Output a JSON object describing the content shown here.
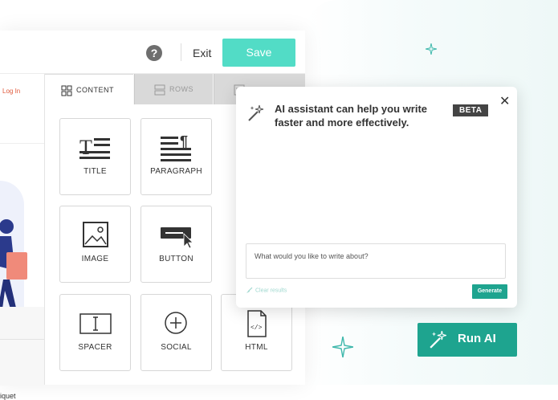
{
  "topbar": {
    "help": "?",
    "exit_label": "Exit",
    "save_label": "Save"
  },
  "canvas_preview": {
    "login_link": "Log In",
    "snippet_text": "iquet"
  },
  "tabs": [
    {
      "label": "CONTENT",
      "icon": "grid-icon"
    },
    {
      "label": "ROWS",
      "icon": "rows-icon"
    },
    {
      "label": "",
      "icon": "settings-icon"
    }
  ],
  "blocks": [
    {
      "label": "TITLE",
      "icon": "title-icon"
    },
    {
      "label": "PARAGRAPH",
      "icon": "paragraph-icon"
    },
    {
      "label": "IMAGE",
      "icon": "image-icon"
    },
    {
      "label": "BUTTON",
      "icon": "button-icon"
    },
    {
      "label": "SPACER",
      "icon": "spacer-icon"
    },
    {
      "label": "SOCIAL",
      "icon": "social-icon"
    },
    {
      "label": "HTML",
      "icon": "html-icon"
    }
  ],
  "ai_popup": {
    "title": "AI assistant can help you write faster and more effectively.",
    "badge": "BETA",
    "close": "✕",
    "prompt_placeholder": "What would you like to write about?",
    "clear_label": "Clear results",
    "generate_label": "Generate"
  },
  "run_ai": {
    "label": "Run AI"
  },
  "colors": {
    "accent": "#1ea48f",
    "save": "#52dcc6",
    "sparkle": "#3fb8ac"
  }
}
